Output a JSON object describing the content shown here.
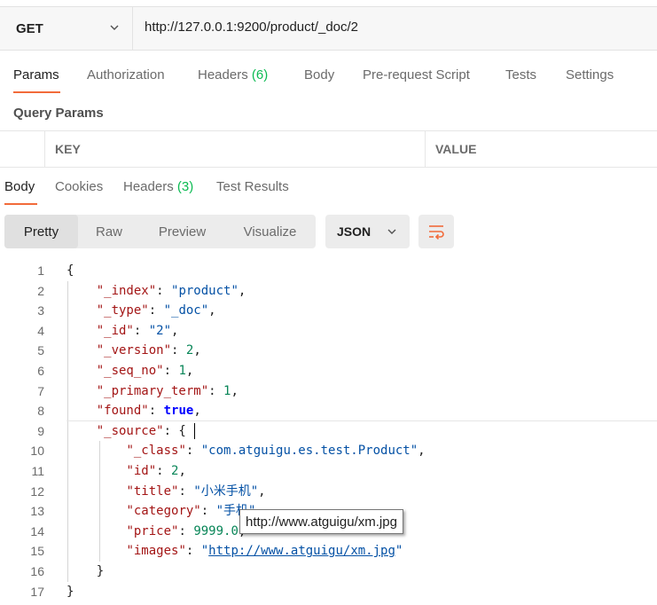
{
  "request": {
    "method": "GET",
    "url": "http://127.0.0.1:9200/product/_doc/2"
  },
  "request_tabs": [
    {
      "label": "Params",
      "count": "",
      "active": true
    },
    {
      "label": "Authorization",
      "count": ""
    },
    {
      "label": "Headers",
      "count": "(6)"
    },
    {
      "label": "Body",
      "count": ""
    },
    {
      "label": "Pre-request Script",
      "count": ""
    },
    {
      "label": "Tests",
      "count": ""
    },
    {
      "label": "Settings",
      "count": ""
    }
  ],
  "query_params": {
    "title": "Query Params",
    "columns": [
      "KEY",
      "VALUE"
    ]
  },
  "response_tabs": [
    {
      "label": "Body",
      "count": "",
      "active": true
    },
    {
      "label": "Cookies",
      "count": ""
    },
    {
      "label": "Headers",
      "count": "(3)"
    },
    {
      "label": "Test Results",
      "count": ""
    }
  ],
  "view_modes": [
    "Pretty",
    "Raw",
    "Preview",
    "Visualize"
  ],
  "active_view_mode": "Pretty",
  "format": "JSON",
  "icons": {
    "method_dropdown": "chevron-down-icon",
    "format_dropdown": "chevron-down-icon",
    "wrap": "wrap-lines-icon"
  },
  "colors": {
    "accent": "#f26b3a",
    "count": "#0cbb52"
  },
  "response_lines": [
    {
      "n": "1",
      "text": "{"
    },
    {
      "n": "2",
      "text": "    \"_index\": \"product\","
    },
    {
      "n": "3",
      "text": "    \"_type\": \"_doc\","
    },
    {
      "n": "4",
      "text": "    \"_id\": \"2\","
    },
    {
      "n": "5",
      "text": "    \"_version\": 2,"
    },
    {
      "n": "6",
      "text": "    \"_seq_no\": 1,"
    },
    {
      "n": "7",
      "text": "    \"_primary_term\": 1,"
    },
    {
      "n": "8",
      "text": "    \"found\": true,"
    },
    {
      "n": "9",
      "text": "    \"_source\": {"
    },
    {
      "n": "10",
      "text": "        \"_class\": \"com.atguigu.es.test.Product\","
    },
    {
      "n": "11",
      "text": "        \"id\": 2,"
    },
    {
      "n": "12",
      "text": "        \"title\": \"小米手机\","
    },
    {
      "n": "13",
      "text": "        \"category\": \"手机\","
    },
    {
      "n": "14",
      "text": "        \"price\": 9999.0,"
    },
    {
      "n": "15",
      "text": "        \"images\": \"http://www.atguigu/xm.jpg\""
    },
    {
      "n": "16",
      "text": "    }"
    },
    {
      "n": "17",
      "text": "}"
    }
  ],
  "tooltip": "http://www.atguigu/xm.jpg"
}
